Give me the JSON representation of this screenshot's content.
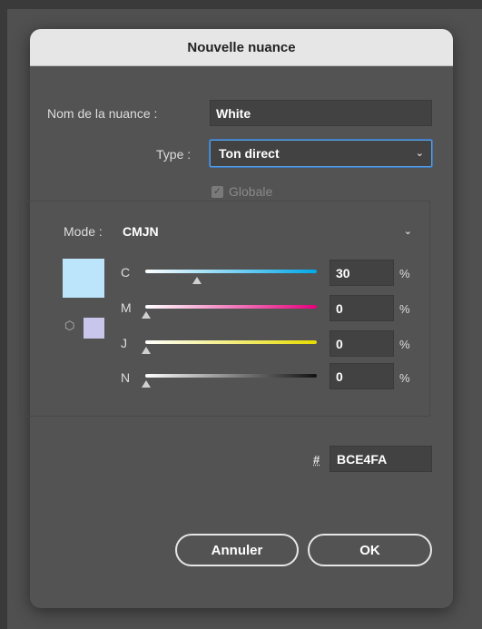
{
  "dialog": {
    "title": "Nouvelle nuance",
    "name_label": "Nom de la nuance :",
    "name_value": "White",
    "type_label": "Type :",
    "type_value": "Ton direct",
    "global_label": "Globale",
    "global_checked": true,
    "mode_label": "Mode :",
    "mode_value": "CMJN"
  },
  "swatch": {
    "color": "#BCE4FA",
    "out_of_gamut_color": "#C9C6EC"
  },
  "channels": [
    {
      "label": "C",
      "value": "30",
      "unit": "%",
      "fraction": 0.3
    },
    {
      "label": "M",
      "value": "0",
      "unit": "%",
      "fraction": 0
    },
    {
      "label": "J",
      "value": "0",
      "unit": "%",
      "fraction": 0
    },
    {
      "label": "N",
      "value": "0",
      "unit": "%",
      "fraction": 0
    }
  ],
  "hex": {
    "symbol": "#",
    "value": "BCE4FA"
  },
  "buttons": {
    "cancel": "Annuler",
    "ok": "OK"
  },
  "icons": {
    "dropdown": "chevron-down-icon",
    "gamut": "cube-icon",
    "check": "checkmark-icon"
  }
}
